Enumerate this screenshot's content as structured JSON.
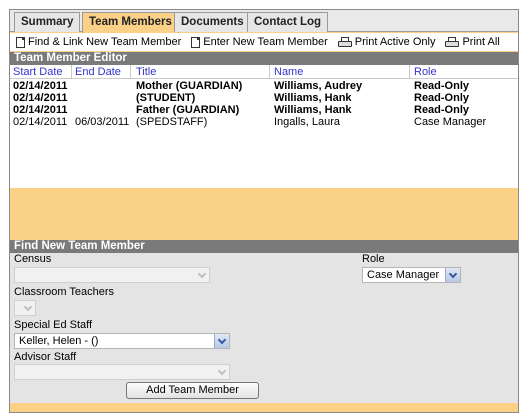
{
  "tabs": [
    {
      "label": "Summary"
    },
    {
      "label": "Team Members"
    },
    {
      "label": "Documents"
    },
    {
      "label": "Contact Log"
    }
  ],
  "toolbar": {
    "find_link": "Find & Link New Team Member",
    "enter_new": "Enter New Team Member",
    "print_active": "Print Active Only",
    "print_all": "Print All"
  },
  "editor": {
    "title": "Team Member Editor",
    "columns": {
      "start_date": "Start Date",
      "end_date": "End Date",
      "title": "Title",
      "name": "Name",
      "role": "Role"
    },
    "rows": [
      {
        "start_date": "02/14/2011",
        "end_date": "",
        "title": "Mother (GUARDIAN)",
        "name": "Williams, Audrey",
        "role": "Read-Only"
      },
      {
        "start_date": "02/14/2011",
        "end_date": "",
        "title": "(STUDENT)",
        "name": "Williams, Hank",
        "role": "Read-Only"
      },
      {
        "start_date": "02/14/2011",
        "end_date": "",
        "title": "Father (GUARDIAN)",
        "name": "Williams, Hank",
        "role": "Read-Only"
      },
      {
        "start_date": "02/14/2011",
        "end_date": "06/03/2011",
        "title": "(SPEDSTAFF)",
        "name": "Ingalls, Laura",
        "role": "Case Manager"
      }
    ]
  },
  "finder": {
    "title": "Find New Team Member",
    "census_label": "Census",
    "census_value": "",
    "role_label": "Role",
    "role_value": "Case Manager",
    "classroom_label": "Classroom Teachers",
    "classroom_value": "",
    "sped_label": "Special Ed Staff",
    "sped_value": "Keller, Helen - ()",
    "advisor_label": "Advisor Staff",
    "advisor_value": "",
    "add_button": "Add Team Member"
  },
  "colors": {
    "accent": "#fbd087",
    "header_bg": "#7a7a7a",
    "column_header_text": "#3333cc"
  }
}
